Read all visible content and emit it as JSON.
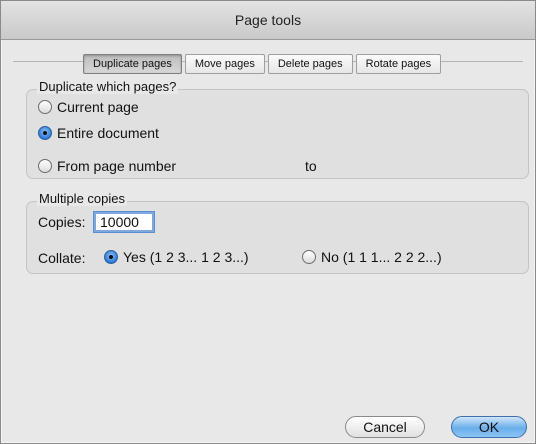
{
  "window": {
    "title": "Page tools"
  },
  "tabs": [
    {
      "label": "Duplicate pages",
      "active": true
    },
    {
      "label": "Move pages",
      "active": false
    },
    {
      "label": "Delete pages",
      "active": false
    },
    {
      "label": "Rotate pages",
      "active": false
    }
  ],
  "duplicate_group": {
    "title": "Duplicate which pages?",
    "options": [
      {
        "label": "Current page",
        "selected": false
      },
      {
        "label": "Entire document",
        "selected": true
      },
      {
        "label": "From page number",
        "selected": false
      }
    ],
    "to_label": "to"
  },
  "copies_group": {
    "title": "Multiple copies",
    "copies_label": "Copies:",
    "copies_value": "10000",
    "collate_label": "Collate:",
    "collate_yes": "Yes (1 2 3... 1 2 3...)",
    "collate_no": "No (1 1 1... 2 2 2...)",
    "collate_selected": "yes"
  },
  "buttons": {
    "cancel": "Cancel",
    "ok": "OK"
  },
  "colors": {
    "accent": "#2c7ad8",
    "background": "#e8e8e8"
  }
}
